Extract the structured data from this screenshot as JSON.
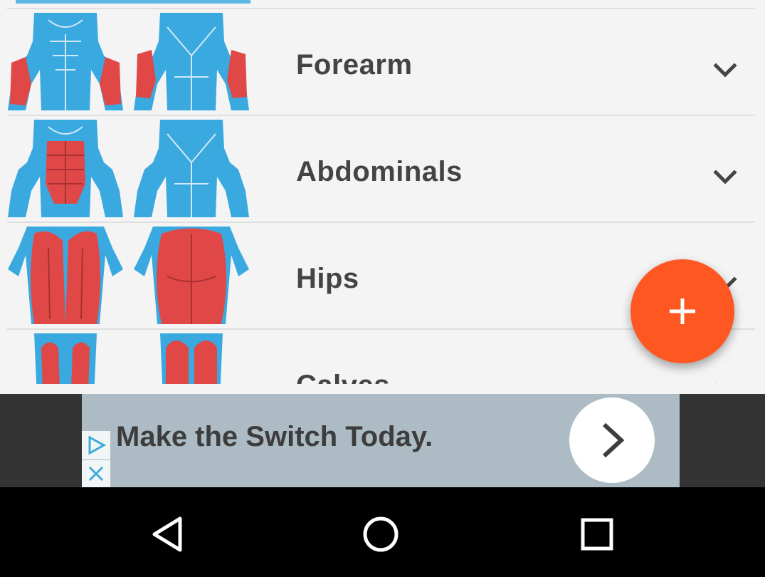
{
  "list": {
    "items": [
      {
        "label": "Forearm",
        "highlight": "forearm"
      },
      {
        "label": "Abdominals",
        "highlight": "abs"
      },
      {
        "label": "Hips",
        "highlight": "hips"
      },
      {
        "label": "Calves",
        "highlight": "calves"
      }
    ],
    "expand_icon": "chevron-down-icon"
  },
  "fab": {
    "icon": "plus-icon"
  },
  "ad": {
    "text": "Make the Switch Today.",
    "cta_icon": "chevron-right-icon",
    "adchoices_icon": "play-triangle-icon",
    "close_icon": "close-icon"
  },
  "navbar": {
    "back_icon": "back-triangle-icon",
    "home_icon": "home-circle-icon",
    "recents_icon": "recents-square-icon"
  },
  "colors": {
    "background": "#f4f4f4",
    "muscle_body": "#3aa9e0",
    "muscle_highlight": "#e04848",
    "fab": "#ff5722",
    "ad_bg": "#adbcc4",
    "navbar": "#000000"
  }
}
